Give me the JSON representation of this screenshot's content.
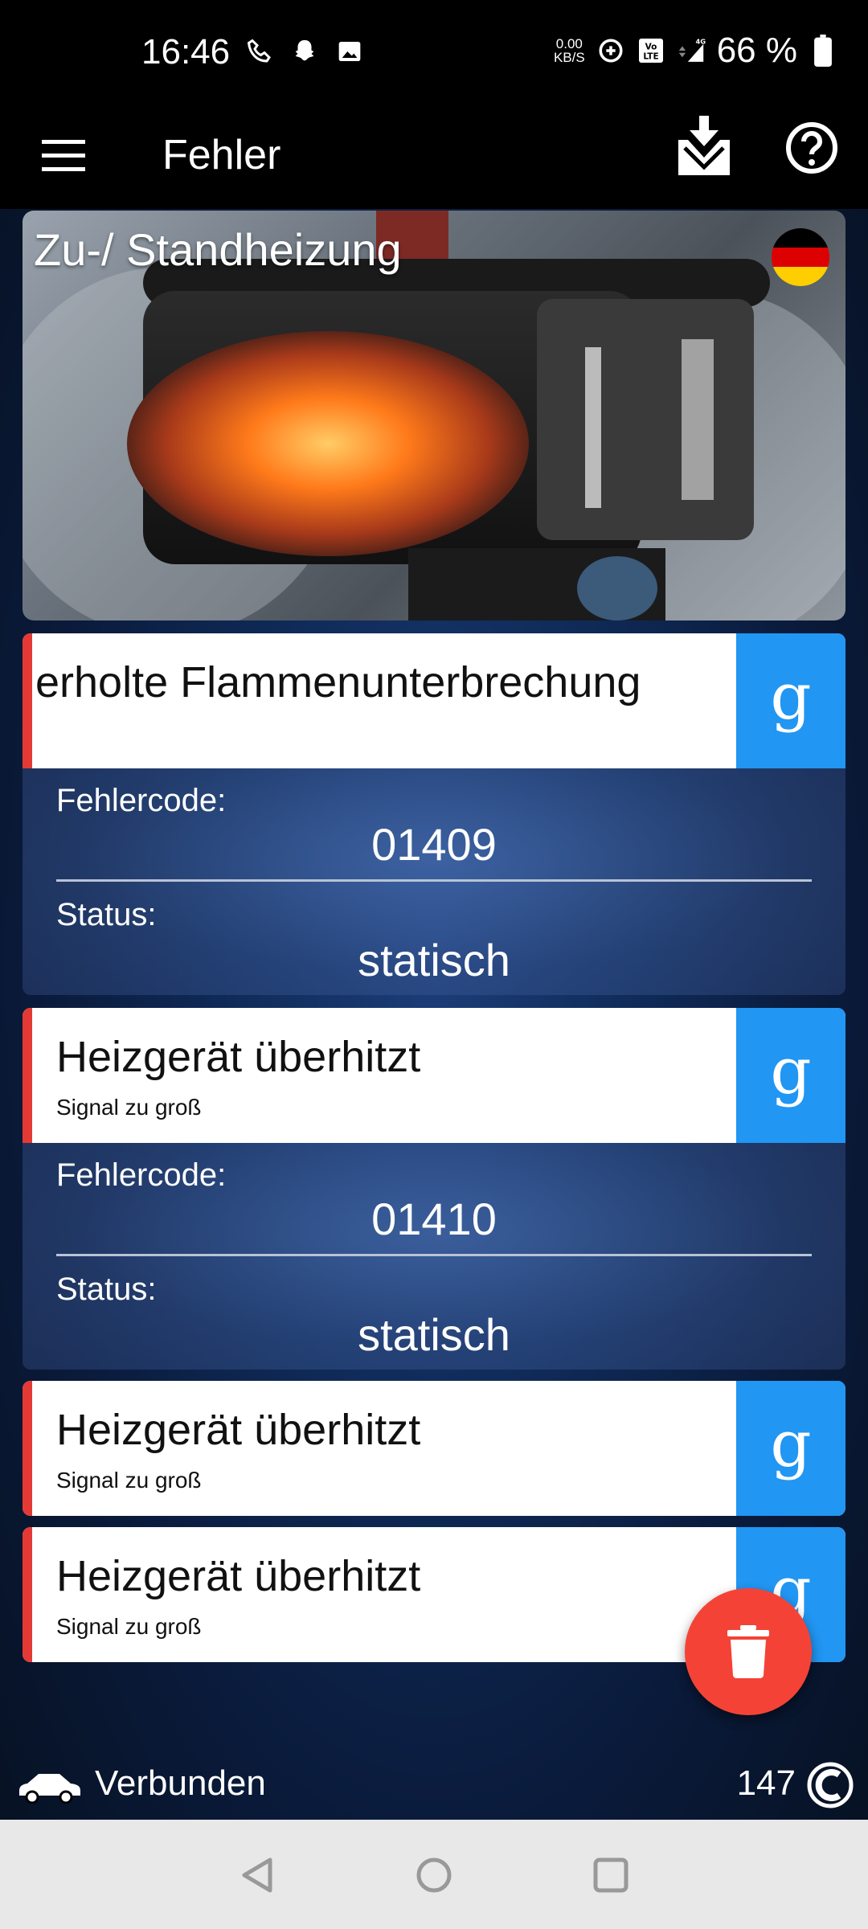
{
  "status_bar": {
    "time": "16:46",
    "speed_value": "0.00",
    "speed_unit": "KB/S",
    "battery": "66 %"
  },
  "app_bar": {
    "title": "Fehler"
  },
  "vehicle": {
    "title": "Zu-/ Standheizung"
  },
  "errors": [
    {
      "title": "erholte Flammenunterbrechung",
      "code_label": "Fehlercode:",
      "code": "01409",
      "status_label": "Status:",
      "status": "statisch",
      "search_label": "g"
    },
    {
      "title": "Heizgerät überhitzt",
      "subtitle": "Signal zu groß",
      "code_label": "Fehlercode:",
      "code": "01410",
      "status_label": "Status:",
      "status": "statisch",
      "search_label": "g"
    },
    {
      "title": "Heizgerät überhitzt",
      "subtitle": "Signal zu groß",
      "search_label": "g"
    },
    {
      "title": "Heizgerät überhitzt",
      "subtitle": "Signal zu groß",
      "search_label": "g"
    }
  ],
  "bottom_bar": {
    "connection": "Verbunden",
    "count": "147"
  },
  "colors": {
    "accent_blue": "#2196f3",
    "error_red": "#e53935",
    "fab_red": "#f44336"
  }
}
